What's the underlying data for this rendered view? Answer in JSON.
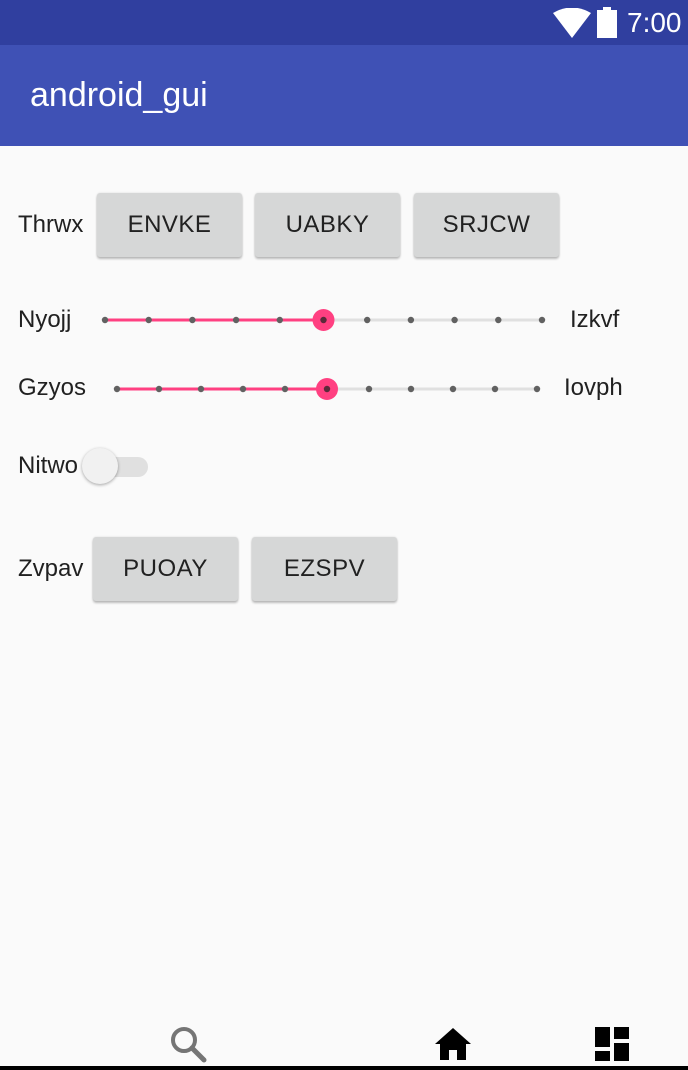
{
  "status_bar": {
    "time": "7:00",
    "icons": [
      "wifi-icon",
      "battery-icon"
    ]
  },
  "app_bar": {
    "title": "android_gui"
  },
  "row1": {
    "label": "Thrwx",
    "buttons": [
      "ENVKE",
      "UABKY",
      "SRJCW"
    ]
  },
  "slider1": {
    "left_label": "Nyojj",
    "right_label": "Izkvf",
    "value": 5,
    "max": 10
  },
  "slider2": {
    "left_label": "Gzyos",
    "right_label": "Iovph",
    "value": 5,
    "max": 10
  },
  "switch_row": {
    "label": "Nitwo",
    "checked": false
  },
  "row2": {
    "label": "Zvpav",
    "buttons": [
      "PUOAY",
      "EZSPV"
    ]
  },
  "bottom_nav": {
    "icons": [
      "search-icon",
      "home-icon",
      "dashboard-icon"
    ]
  },
  "colors": {
    "status_bar": "#303f9f",
    "app_bar": "#3f51b5",
    "accent": "#ff4081",
    "button": "#d6d7d7"
  }
}
